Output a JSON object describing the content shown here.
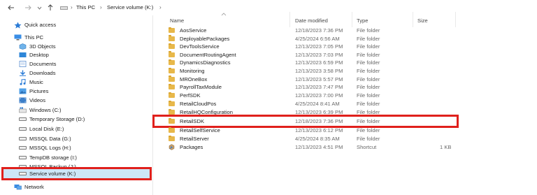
{
  "window": {
    "title": "Service volume (K:)"
  },
  "addressbar": {
    "back_icon": "arrow-left-icon",
    "forward_icon": "arrow-right-icon",
    "up_icon": "arrow-up-icon",
    "crumbs": [
      "This PC",
      "Service volume (K:)"
    ]
  },
  "sidebar": {
    "items": [
      {
        "label": "Quick access",
        "icon": "star-icon"
      },
      {
        "label": "This PC",
        "icon": "computer-icon"
      },
      {
        "label": "3D Objects",
        "icon": "cube-icon"
      },
      {
        "label": "Desktop",
        "icon": "desktop-icon"
      },
      {
        "label": "Documents",
        "icon": "document-icon"
      },
      {
        "label": "Downloads",
        "icon": "download-icon"
      },
      {
        "label": "Music",
        "icon": "music-icon"
      },
      {
        "label": "Pictures",
        "icon": "picture-icon"
      },
      {
        "label": "Videos",
        "icon": "video-icon"
      },
      {
        "label": "Windows (C:)",
        "icon": "windows-drive-icon"
      },
      {
        "label": "Temporary Storage (D:)",
        "icon": "drive-icon"
      },
      {
        "label": "Local Disk (E:)",
        "icon": "drive-icon"
      },
      {
        "label": "MSSQL Data (G:)",
        "icon": "drive-icon"
      },
      {
        "label": "MSSQL Logs (H:)",
        "icon": "drive-icon"
      },
      {
        "label": "TempDB storage (I:)",
        "icon": "drive-icon"
      },
      {
        "label": "MSSQL Backup (J:)",
        "icon": "drive-icon"
      },
      {
        "label": "Service volume (K:)",
        "icon": "drive-icon"
      },
      {
        "label": "Network",
        "icon": "network-icon"
      }
    ],
    "selected": "Service volume (K:)"
  },
  "columns": {
    "name": "Name",
    "date": "Date modified",
    "type": "Type",
    "size": "Size"
  },
  "files": [
    {
      "name": "AosService",
      "date": "12/18/2023 7:36 PM",
      "type": "File folder",
      "size": ""
    },
    {
      "name": "DeployablePackages",
      "date": "4/25/2024 6:56 AM",
      "type": "File folder",
      "size": ""
    },
    {
      "name": "DevToolsService",
      "date": "12/13/2023 7:05 PM",
      "type": "File folder",
      "size": ""
    },
    {
      "name": "DocumentRoutingAgent",
      "date": "12/13/2023 7:03 PM",
      "type": "File folder",
      "size": ""
    },
    {
      "name": "DynamicsDiagnostics",
      "date": "12/13/2023 6:59 PM",
      "type": "File folder",
      "size": ""
    },
    {
      "name": "Monitoring",
      "date": "12/13/2023 3:58 PM",
      "type": "File folder",
      "size": ""
    },
    {
      "name": "MROneBox",
      "date": "12/13/2023 5:57 PM",
      "type": "File folder",
      "size": ""
    },
    {
      "name": "PayrollTaxModule",
      "date": "12/13/2023 7:47 PM",
      "type": "File folder",
      "size": ""
    },
    {
      "name": "PerfSDK",
      "date": "12/13/2023 7:00 PM",
      "type": "File folder",
      "size": ""
    },
    {
      "name": "RetailCloudPos",
      "date": "4/25/2024 8:41 AM",
      "type": "File folder",
      "size": ""
    },
    {
      "name": "RetailHQConfiguration",
      "date": "12/13/2023 6:39 PM",
      "type": "File folder",
      "size": ""
    },
    {
      "name": "RetailSDK",
      "date": "12/18/2023 7:36 PM",
      "type": "File folder",
      "size": ""
    },
    {
      "name": "RetailSelfService",
      "date": "12/13/2023 6:12 PM",
      "type": "File folder",
      "size": ""
    },
    {
      "name": "RetailServer",
      "date": "4/25/2024 8:35 AM",
      "type": "File folder",
      "size": ""
    },
    {
      "name": "Packages",
      "date": "12/13/2023 4:51 PM",
      "type": "Shortcut",
      "size": "1 KB"
    }
  ],
  "highlighted_file": "RetailSDK",
  "colors": {
    "highlight_border": "#e0201c",
    "folder": "#e8b84a",
    "selection": "#cde6f7"
  }
}
